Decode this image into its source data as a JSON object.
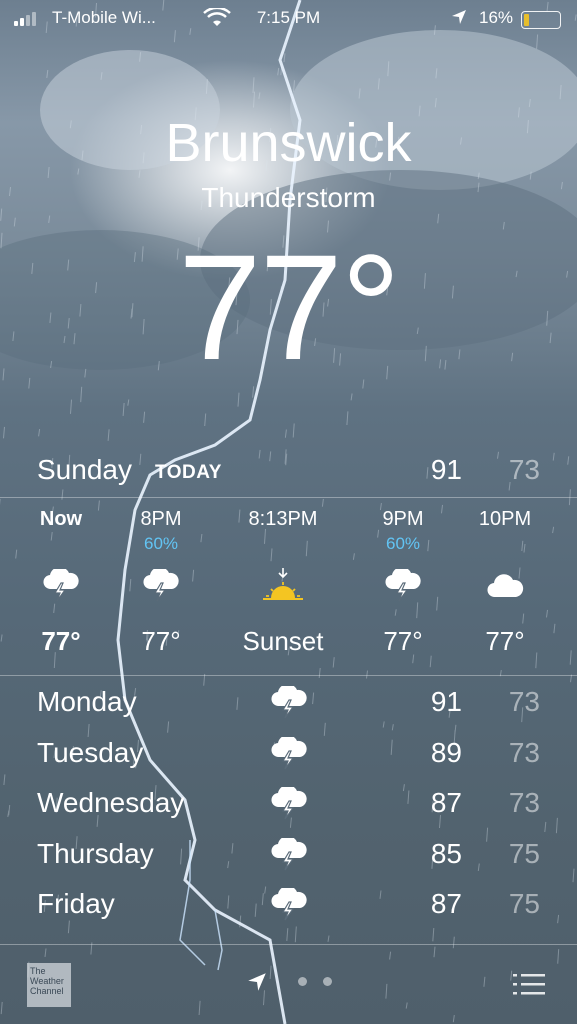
{
  "status_bar": {
    "carrier": "T-Mobile Wi...",
    "time": "7:15 PM",
    "battery": "16%"
  },
  "location": {
    "city": "Brunswick",
    "condition": "Thunderstorm",
    "temperature": "77°"
  },
  "today": {
    "day": "Sunday",
    "label": "TODAY",
    "high": "91",
    "low": "73"
  },
  "hourly": [
    {
      "time": "Now",
      "precip": "",
      "icon": "thunderstorm-icon",
      "temp": "77°"
    },
    {
      "time": "8PM",
      "precip": "60%",
      "icon": "thunderstorm-icon",
      "temp": "77°"
    },
    {
      "time": "8:13PM",
      "precip": "",
      "icon": "sunset-icon",
      "temp": "Sunset"
    },
    {
      "time": "9PM",
      "precip": "60%",
      "icon": "thunderstorm-icon",
      "temp": "77°"
    },
    {
      "time": "10PM",
      "precip": "",
      "icon": "cloud-icon",
      "temp": "77°"
    }
  ],
  "daily": [
    {
      "day": "Monday",
      "icon": "thunderstorm-icon",
      "high": "91",
      "low": "73"
    },
    {
      "day": "Tuesday",
      "icon": "thunderstorm-icon",
      "high": "89",
      "low": "73"
    },
    {
      "day": "Wednesday",
      "icon": "thunderstorm-icon",
      "high": "87",
      "low": "73"
    },
    {
      "day": "Thursday",
      "icon": "thunderstorm-icon",
      "high": "85",
      "low": "75"
    },
    {
      "day": "Friday",
      "icon": "thunderstorm-icon",
      "high": "87",
      "low": "75"
    }
  ],
  "bottom_bar": {
    "logo_text": "The Weather Channel"
  },
  "colors": {
    "precip": "#62c4f4",
    "sun": "#f4c522"
  }
}
